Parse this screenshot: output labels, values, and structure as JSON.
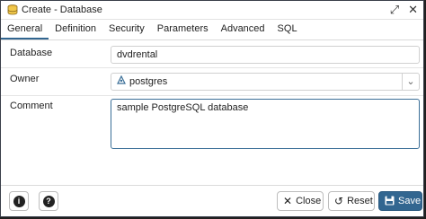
{
  "window": {
    "title": "Create - Database",
    "title_icon": "database-icon",
    "tools": [
      "expand-icon",
      "close-icon"
    ]
  },
  "tabs": [
    {
      "label": "General",
      "active": true
    },
    {
      "label": "Definition",
      "active": false
    },
    {
      "label": "Security",
      "active": false
    },
    {
      "label": "Parameters",
      "active": false
    },
    {
      "label": "Advanced",
      "active": false
    },
    {
      "label": "SQL",
      "active": false
    }
  ],
  "form": {
    "database": {
      "label": "Database",
      "value": "dvdrental"
    },
    "owner": {
      "label": "Owner",
      "value": "postgres",
      "icon": "user-icon"
    },
    "comment": {
      "label": "Comment",
      "value": "sample PostgreSQL database"
    }
  },
  "footer": {
    "info_icon": "info-icon",
    "help_icon": "help-icon",
    "close_label": "Close",
    "reset_label": "Reset",
    "save_label": "Save"
  },
  "colors": {
    "accent": "#326690",
    "focus_border": "#3a6e97"
  }
}
